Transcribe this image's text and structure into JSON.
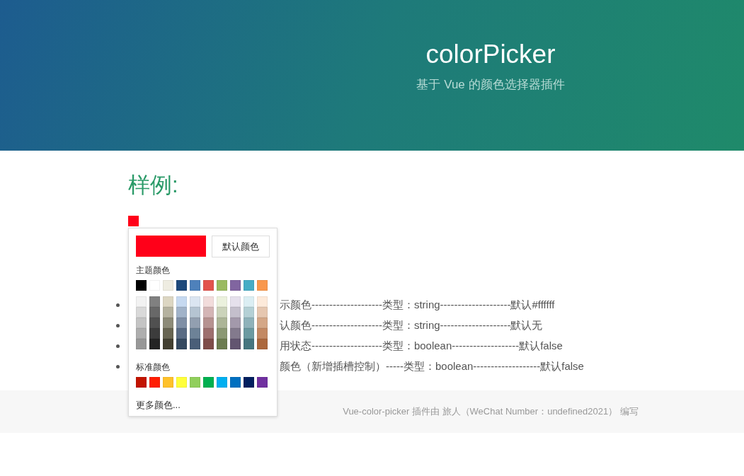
{
  "header": {
    "title": "colorPicker",
    "subtitle": "基于 Vue 的颜色选择器插件"
  },
  "section": {
    "title": "样例:"
  },
  "picker": {
    "color": "#ff0019",
    "default_button": "默认颜色",
    "theme_label": "主题颜色",
    "theme_colors": [
      {
        "color": "#000000"
      },
      {
        "color": "#ffffff"
      },
      {
        "color": "#eeece1"
      },
      {
        "color": "#1e497b"
      },
      {
        "color": "#4e81bb"
      },
      {
        "color": "#e2534d"
      },
      {
        "color": "#9aba60"
      },
      {
        "color": "#8165a0"
      },
      {
        "color": "#47acc5"
      },
      {
        "color": "#f9974c"
      }
    ],
    "shade_columns": [
      {
        "shades": [
          {
            "color": "#f2f2f2"
          },
          {
            "color": "#d9d9d9"
          },
          {
            "color": "#c4c4c4"
          },
          {
            "color": "#aeaeae"
          },
          {
            "color": "#989898"
          }
        ]
      },
      {
        "shades": [
          {
            "color": "#808080"
          },
          {
            "color": "#686868"
          },
          {
            "color": "#505050"
          },
          {
            "color": "#3c3c3c"
          },
          {
            "color": "#242424"
          }
        ]
      },
      {
        "shades": [
          {
            "color": "#dcd6c2"
          },
          {
            "color": "#b5b29f"
          },
          {
            "color": "#8d8b78"
          },
          {
            "color": "#686552"
          },
          {
            "color": "#434031"
          }
        ]
      },
      {
        "shades": [
          {
            "color": "#c6d9f0"
          },
          {
            "color": "#a1b3c9"
          },
          {
            "color": "#7f8fa6"
          },
          {
            "color": "#596b84"
          },
          {
            "color": "#344960"
          }
        ]
      },
      {
        "shades": [
          {
            "color": "#dbe5f1"
          },
          {
            "color": "#b5c4d2"
          },
          {
            "color": "#929fb0"
          },
          {
            "color": "#6d8297"
          },
          {
            "color": "#4a5e78"
          }
        ]
      },
      {
        "shades": [
          {
            "color": "#f2dcdb"
          },
          {
            "color": "#d4b5b5"
          },
          {
            "color": "#b69290"
          },
          {
            "color": "#9d6f6e"
          },
          {
            "color": "#7f4d4a"
          }
        ]
      },
      {
        "shades": [
          {
            "color": "#ebf1dd"
          },
          {
            "color": "#cbd3ba"
          },
          {
            "color": "#acb597"
          },
          {
            "color": "#8b9873"
          },
          {
            "color": "#6c7c50"
          }
        ]
      },
      {
        "shades": [
          {
            "color": "#e5e0ec"
          },
          {
            "color": "#c4bfcc"
          },
          {
            "color": "#a399ab"
          },
          {
            "color": "#837a8d"
          },
          {
            "color": "#625570"
          }
        ]
      },
      {
        "shades": [
          {
            "color": "#dbeef3"
          },
          {
            "color": "#b4d0d5"
          },
          {
            "color": "#8fb2ba"
          },
          {
            "color": "#6b9aa1"
          },
          {
            "color": "#477680"
          }
        ]
      },
      {
        "shades": [
          {
            "color": "#fdeada"
          },
          {
            "color": "#e6c7b0"
          },
          {
            "color": "#d4a787"
          },
          {
            "color": "#c38963"
          },
          {
            "color": "#ac683d"
          }
        ]
      }
    ],
    "standard_label": "标准颜色",
    "standard_colors": [
      {
        "color": "#c21401"
      },
      {
        "color": "#ff1e02"
      },
      {
        "color": "#ffc12a"
      },
      {
        "color": "#ffff3a"
      },
      {
        "color": "#90cf5b"
      },
      {
        "color": "#00b050"
      },
      {
        "color": "#00aff0"
      },
      {
        "color": "#0070c0"
      },
      {
        "color": "#001f5f"
      },
      {
        "color": "#7030a0"
      }
    ],
    "more_link": "更多颜色..."
  },
  "props": [
    {
      "text": "示颜色--------------------类型：string--------------------默认#ffffff"
    },
    {
      "text": "认颜色--------------------类型：string--------------------默认无"
    },
    {
      "text": "用状态--------------------类型：boolean-------------------默认false"
    },
    {
      "text": "颜色（新增插槽控制）-----类型：boolean-------------------默认false"
    }
  ],
  "footer": {
    "text": "Vue-color-picker 插件由 旅人（WeChat Number：undefined2021） 编写"
  }
}
